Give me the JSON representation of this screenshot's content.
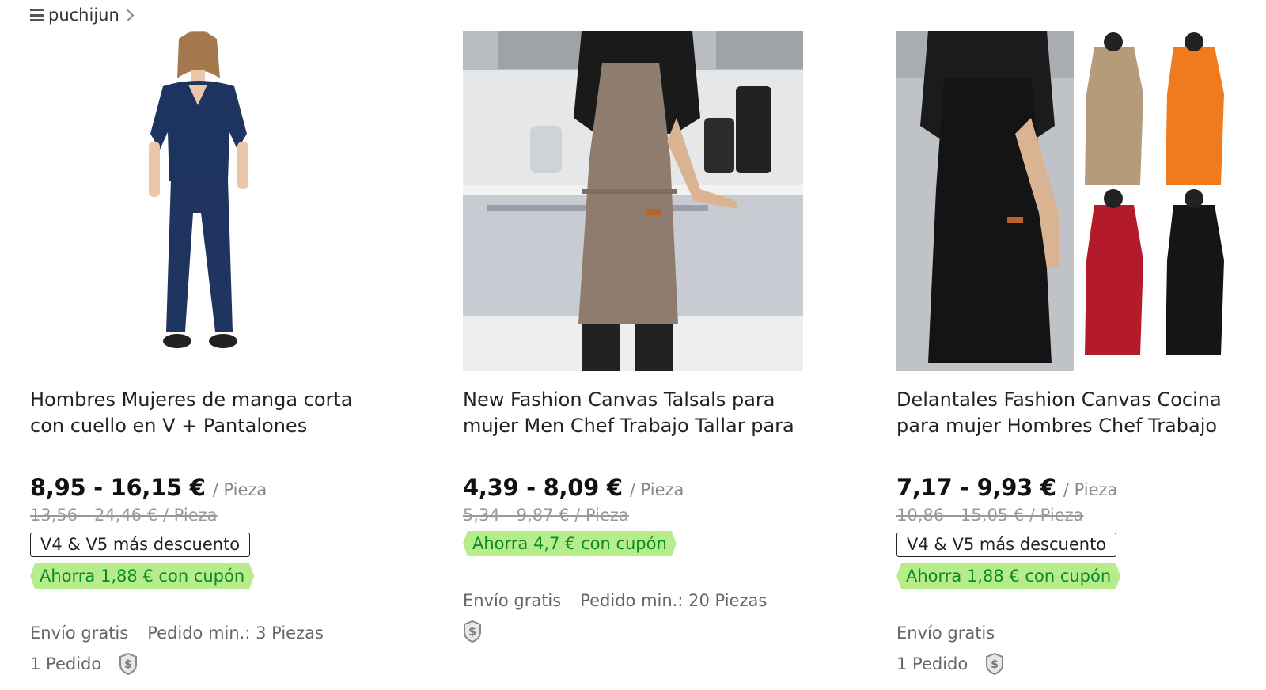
{
  "store": {
    "name": "puchijun"
  },
  "products": [
    {
      "title": "Hombres Mujeres de manga corta con cuello en V + Pantalones",
      "price": "8,95 - 16,15 €",
      "unit": "/ Pieza",
      "original_price": "13,56 - 24,46 € / Pieza",
      "vip_badge": "V4 & V5 más descuento",
      "coupon": "Ahorra 1,88 € con cupón",
      "shipping": "Envío gratis",
      "min_order": "Pedido min.: 3 Piezas",
      "orders": "1 Pedido"
    },
    {
      "title": "New Fashion Canvas Talsals para mujer Men Chef Trabajo Tallar para",
      "price": "4,39 - 8,09 €",
      "unit": "/ Pieza",
      "original_price": "5,34 - 9,87 € / Pieza",
      "coupon": "Ahorra 4,7 € con cupón",
      "shipping": "Envío gratis",
      "min_order": "Pedido min.: 20 Piezas"
    },
    {
      "title": "Delantales Fashion Canvas Cocina para mujer Hombres Chef Trabajo",
      "price": "7,17 - 9,93 €",
      "unit": "/ Pieza",
      "original_price": "10,86 - 15,05 € / Pieza",
      "vip_badge": "V4 & V5 más descuento",
      "coupon": "Ahorra 1,88 € con cupón",
      "shipping": "Envío gratis",
      "orders": "1 Pedido"
    }
  ],
  "colors": {
    "coupon_bg": "#b6ec8a",
    "coupon_text": "#0b8a2a",
    "muted": "#888888"
  },
  "icons": [
    "menu-icon",
    "chevron-right-icon",
    "dollar-shield-icon"
  ]
}
